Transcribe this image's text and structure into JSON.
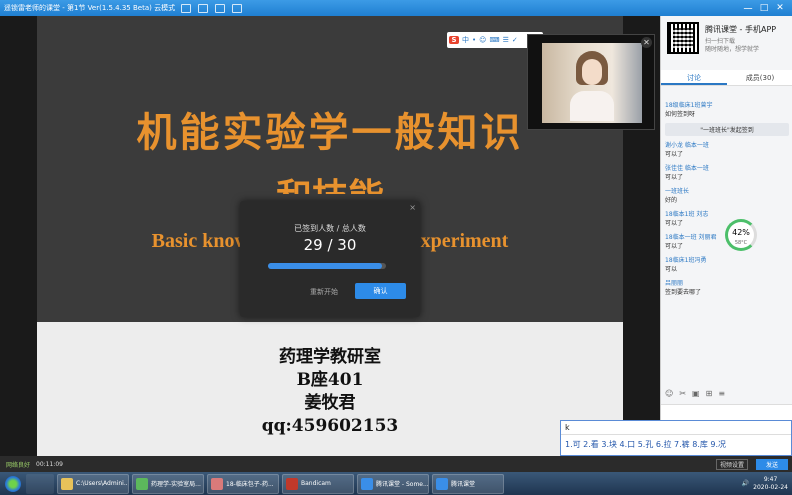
{
  "window": {
    "title": "遥锁雷老师的课堂 - 第1节 Ver(1.5.4.35 Beta) 云模式",
    "controls": [
      "一",
      "□",
      "✕"
    ]
  },
  "slide_toolbar": {
    "s": "S",
    "items": [
      "中",
      "•",
      "☺",
      "⌨",
      "☰",
      "✓"
    ]
  },
  "slide": {
    "title_line1": "机能实验学一般知识",
    "title_line2": "和技能",
    "english": "Basic knowledge of functional experiment",
    "lines": [
      "药理学教研室",
      "B座401",
      "姜牧君",
      "qq:459602153"
    ]
  },
  "camera": {
    "close": "✕"
  },
  "checkin": {
    "close": "×",
    "label": "已签到人数 / 总人数",
    "count": "29 / 30",
    "progress": 0.967,
    "restart": "重新开始",
    "confirm": "确认"
  },
  "sidebar": {
    "app_title": "腾讯课堂 - 手机APP",
    "app_sub1": "扫一扫下载",
    "app_sub2": "随时随地，想学就学",
    "tabs": [
      "讨论",
      "成员(30)"
    ],
    "messages": [
      {
        "name": "18级临床1班曾宇",
        "text": "如何签到呀"
      },
      {
        "name": "",
        "text": "",
        "system": "\"一班班长\"发起签到"
      },
      {
        "name": "谢小龙 临本一班",
        "text": "可以了"
      },
      {
        "name": "张佳佳 临本一班",
        "text": "可以了"
      },
      {
        "name": "一班班长",
        "text": "好的"
      },
      {
        "name": "18临本1班 刘志",
        "text": "可以了"
      },
      {
        "name": "18临本一班 刘丽君",
        "text": "可以了"
      },
      {
        "name": "18临床1班冯勇",
        "text": "可以"
      },
      {
        "name": "吕丽丽",
        "text": "签到要去哪了"
      }
    ],
    "ring_value": "42%",
    "ring_sub": "58°C",
    "tools": [
      "☺",
      "✂",
      "▣",
      "⊞",
      "≡"
    ]
  },
  "ime": {
    "input": "k",
    "candidates": "1.可 2.看 3.块 4.口 5.孔 6.拉 7.裤 8.库 9.况"
  },
  "statusbar": {
    "net": "网络良好",
    "time": "00:11:09",
    "record": "视频设置",
    "send": "发送"
  },
  "taskbar": {
    "tasks": [
      {
        "label": "C:\\Users\\Admini...",
        "color": "#e8c25a"
      },
      {
        "label": "药理学-实验室局...",
        "color": "#5cb85c"
      },
      {
        "label": "18-临床包子-药...",
        "color": "#d97a7a"
      },
      {
        "label": "Bandicam",
        "color": "#c0392b"
      },
      {
        "label": "腾讯课堂 - Some...",
        "color": "#3a8ee8"
      },
      {
        "label": "腾讯课堂",
        "color": "#3a8ee8"
      }
    ],
    "clock_time": "9:47",
    "clock_date": "2020-02-24"
  }
}
